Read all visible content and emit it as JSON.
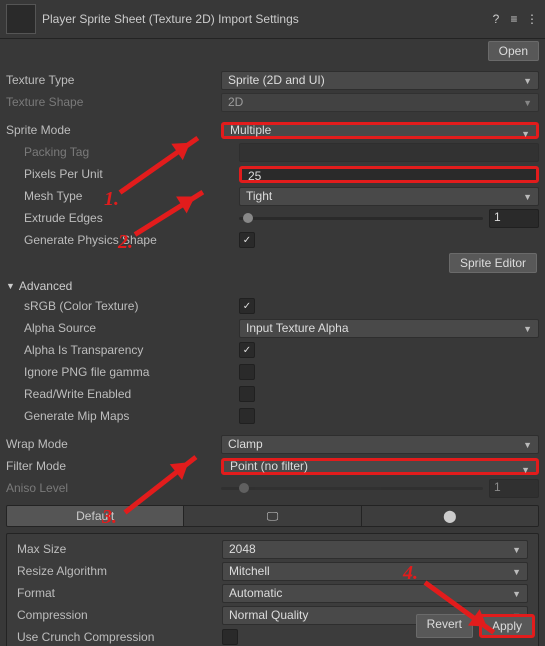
{
  "header": {
    "title": "Player Sprite Sheet (Texture 2D) Import Settings",
    "open": "Open"
  },
  "textureType": {
    "lbl": "Texture Type",
    "val": "Sprite (2D and UI)"
  },
  "textureShape": {
    "lbl": "Texture Shape",
    "val": "2D"
  },
  "spriteMode": {
    "lbl": "Sprite Mode",
    "val": "Multiple"
  },
  "packingTag": {
    "lbl": "Packing Tag"
  },
  "ppu": {
    "lbl": "Pixels Per Unit",
    "val": "25"
  },
  "meshType": {
    "lbl": "Mesh Type",
    "val": "Tight"
  },
  "extrude": {
    "lbl": "Extrude Edges",
    "val": "1"
  },
  "genPhysics": {
    "lbl": "Generate Physics Shape"
  },
  "spriteEditor": "Sprite Editor",
  "advanced": {
    "lbl": "Advanced"
  },
  "srgb": {
    "lbl": "sRGB (Color Texture)"
  },
  "alphaSource": {
    "lbl": "Alpha Source",
    "val": "Input Texture Alpha"
  },
  "alphaTrans": {
    "lbl": "Alpha Is Transparency"
  },
  "ignoreGamma": {
    "lbl": "Ignore PNG file gamma"
  },
  "readWrite": {
    "lbl": "Read/Write Enabled"
  },
  "genMip": {
    "lbl": "Generate Mip Maps"
  },
  "wrapMode": {
    "lbl": "Wrap Mode",
    "val": "Clamp"
  },
  "filterMode": {
    "lbl": "Filter Mode",
    "val": "Point (no filter)"
  },
  "aniso": {
    "lbl": "Aniso Level",
    "val": "1"
  },
  "tabs": {
    "default": "Default"
  },
  "maxSize": {
    "lbl": "Max Size",
    "val": "2048"
  },
  "resize": {
    "lbl": "Resize Algorithm",
    "val": "Mitchell"
  },
  "format": {
    "lbl": "Format",
    "val": "Automatic"
  },
  "compression": {
    "lbl": "Compression",
    "val": "Normal Quality"
  },
  "crunch": {
    "lbl": "Use Crunch Compression"
  },
  "footer": {
    "revert": "Revert",
    "apply": "Apply"
  },
  "annotations": {
    "a1": "1.",
    "a2": "2.",
    "a3": "3.",
    "a4": "4."
  },
  "colors": {
    "highlight": "#e21c1c"
  }
}
